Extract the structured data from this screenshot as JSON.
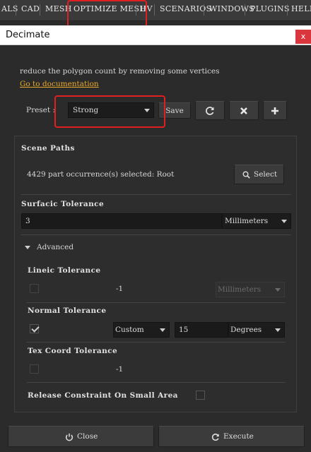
{
  "menubar": {
    "items": [
      "ALS",
      "CAD",
      "MESH",
      "OPTIMIZE MESH",
      "UV",
      "SCENARIOS",
      "WINDOWS",
      "PLUGINS",
      "HELP"
    ]
  },
  "dialog": {
    "title": "Decimate",
    "close_glyph": "x"
  },
  "description": "reduce the polygon count by removing some vertices",
  "doc_link": "Go to documentation",
  "preset": {
    "label": "Preset :",
    "value": "Strong",
    "save_label": "Save",
    "icons": [
      "refresh-icon",
      "delete-icon",
      "add-icon"
    ]
  },
  "scene_paths": {
    "heading": "Scene Paths",
    "selection_text": "4429 part occurrence(s) selected: Root",
    "select_label": "Select"
  },
  "surfacic": {
    "heading": "Surfacic Tolerance",
    "value": "3",
    "unit": "Millimeters"
  },
  "advanced": {
    "label": "Advanced",
    "lineic": {
      "heading": "Lineic Tolerance",
      "value": "-1",
      "unit": "Millimeters",
      "checked": false
    },
    "normal": {
      "heading": "Normal Tolerance",
      "mode": "Custom",
      "value": "15",
      "unit": "Degrees",
      "checked": true
    },
    "texcoord": {
      "heading": "Tex Coord Tolerance",
      "value": "-1",
      "checked": false
    }
  },
  "release_constraint": {
    "label": "Release Constraint On Small Area",
    "checked": false
  },
  "footer": {
    "close_label": "Close",
    "execute_label": "Execute"
  },
  "colors": {
    "accent_link": "#e8a82a",
    "highlight_red": "#e02020",
    "background": "#2b2b2b"
  }
}
